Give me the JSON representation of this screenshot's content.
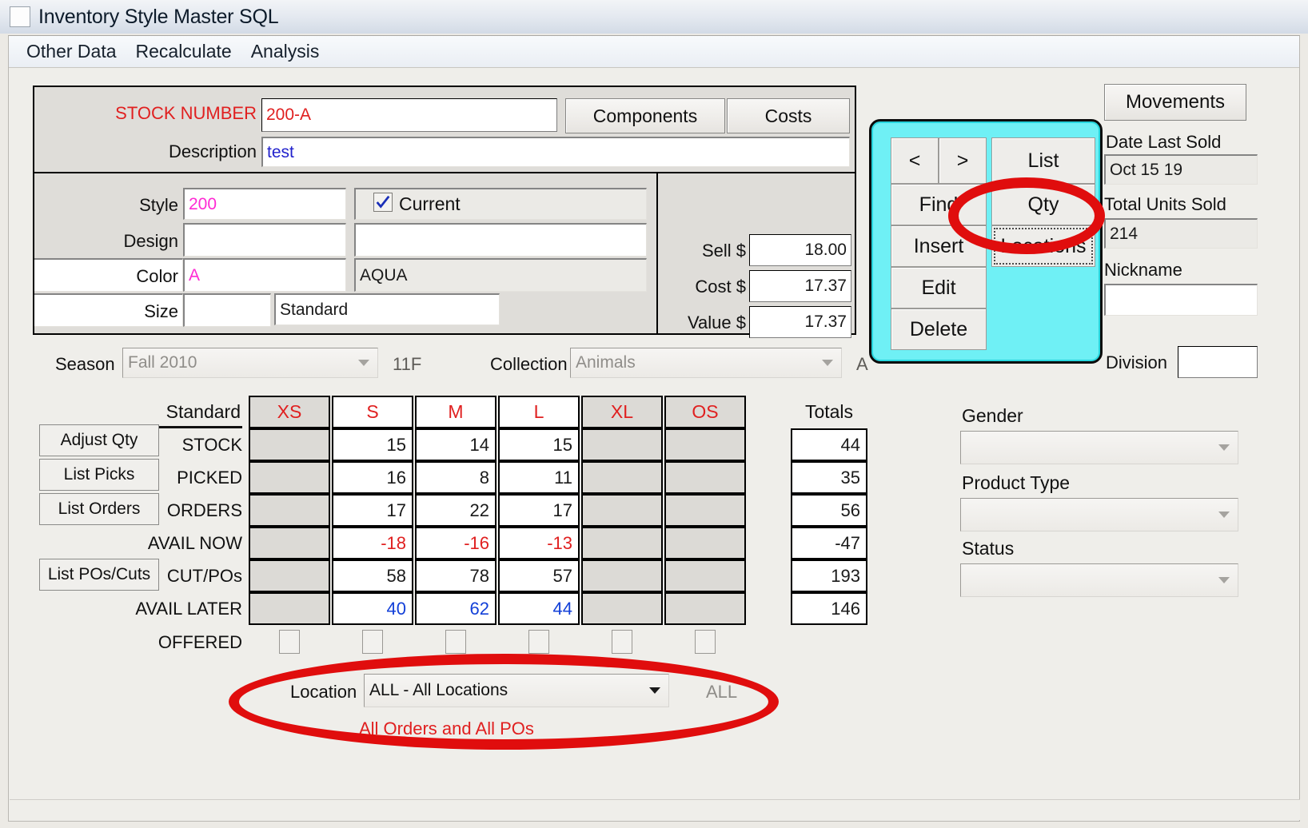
{
  "window": {
    "title": "Inventory Style Master SQL",
    "menu": [
      "Other Data",
      "Recalculate",
      "Analysis"
    ]
  },
  "header": {
    "stock_number_label": "STOCK NUMBER",
    "stock_number_value": "200-A",
    "description_label": "Description",
    "description_value": "test",
    "components_button": "Components",
    "costs_button": "Costs"
  },
  "attributes": {
    "style_label": "Style",
    "style_value": "200",
    "design_label": "Design",
    "design_value": "",
    "design_desc": "",
    "color_label": "Color",
    "color_value": "A",
    "color_desc": "AQUA",
    "size_label": "Size",
    "size_value": "",
    "size_desc": "Standard",
    "current_checkbox_label": "Current",
    "current_checked": true
  },
  "pricing": {
    "sell_label": "Sell $",
    "sell_value": "18.00",
    "cost_label": "Cost $",
    "cost_value": "17.37",
    "value_label": "Value $",
    "value_value": "17.37"
  },
  "nav": {
    "prev": "<",
    "next": ">",
    "list": "List",
    "find": "Find",
    "qty": "Qty",
    "insert": "Insert",
    "locations": "Locations",
    "edit": "Edit",
    "delete": "Delete"
  },
  "sidebar": {
    "movements_button": "Movements",
    "date_last_sold_label": "Date Last Sold",
    "date_last_sold_value": "Oct 15 19",
    "total_units_sold_label": "Total Units Sold",
    "total_units_sold_value": "214",
    "nickname_label": "Nickname",
    "nickname_value": ""
  },
  "season_row": {
    "season_label": "Season",
    "season_value": "Fall  2010",
    "season_code": "11F",
    "collection_label": "Collection",
    "collection_value": "Animals",
    "collection_code": "A",
    "division_label": "Division",
    "division_value": ""
  },
  "grid": {
    "scale_label": "Standard",
    "totals_label": "Totals",
    "columns": [
      "XS",
      "S",
      "M",
      "L",
      "XL",
      "OS"
    ],
    "column_enabled": [
      false,
      true,
      true,
      true,
      false,
      false
    ],
    "rows": [
      {
        "label": "STOCK",
        "values": [
          "",
          "15",
          "14",
          "15",
          "",
          ""
        ],
        "total": "44",
        "style": "plain"
      },
      {
        "label": "PICKED",
        "values": [
          "",
          "16",
          "8",
          "11",
          "",
          ""
        ],
        "total": "35",
        "style": "plain"
      },
      {
        "label": "ORDERS",
        "values": [
          "",
          "17",
          "22",
          "17",
          "",
          ""
        ],
        "total": "56",
        "style": "plain"
      },
      {
        "label": "AVAIL NOW",
        "values": [
          "",
          "-18",
          "-16",
          "-13",
          "",
          ""
        ],
        "total": "-47",
        "style": "neg"
      },
      {
        "label": "CUT/POs",
        "values": [
          "",
          "58",
          "78",
          "57",
          "",
          ""
        ],
        "total": "193",
        "style": "plain"
      },
      {
        "label": "AVAIL LATER",
        "values": [
          "",
          "40",
          "62",
          "44",
          "",
          ""
        ],
        "total": "146",
        "style": "blue"
      }
    ],
    "offered_label": "OFFERED",
    "offered_checked": [
      false,
      false,
      false,
      false,
      false,
      false
    ],
    "side_buttons": [
      "Adjust Qty",
      "List Picks",
      "List Orders",
      "List POs/Cuts"
    ]
  },
  "location": {
    "label": "Location",
    "value": "ALL - All Locations",
    "code": "ALL",
    "note": "All Orders and All POs"
  },
  "classification": {
    "gender_label": "Gender",
    "gender_value": "",
    "product_type_label": "Product Type",
    "product_type_value": "",
    "status_label": "Status",
    "status_value": ""
  },
  "colors": {
    "accent_cyan": "#6ff0f5",
    "annotation_red": "#e00d0d",
    "label_red": "#e02020",
    "value_magenta": "#ff2ad4",
    "value_blue": "#1340d8",
    "description_blue": "#2222cc"
  }
}
